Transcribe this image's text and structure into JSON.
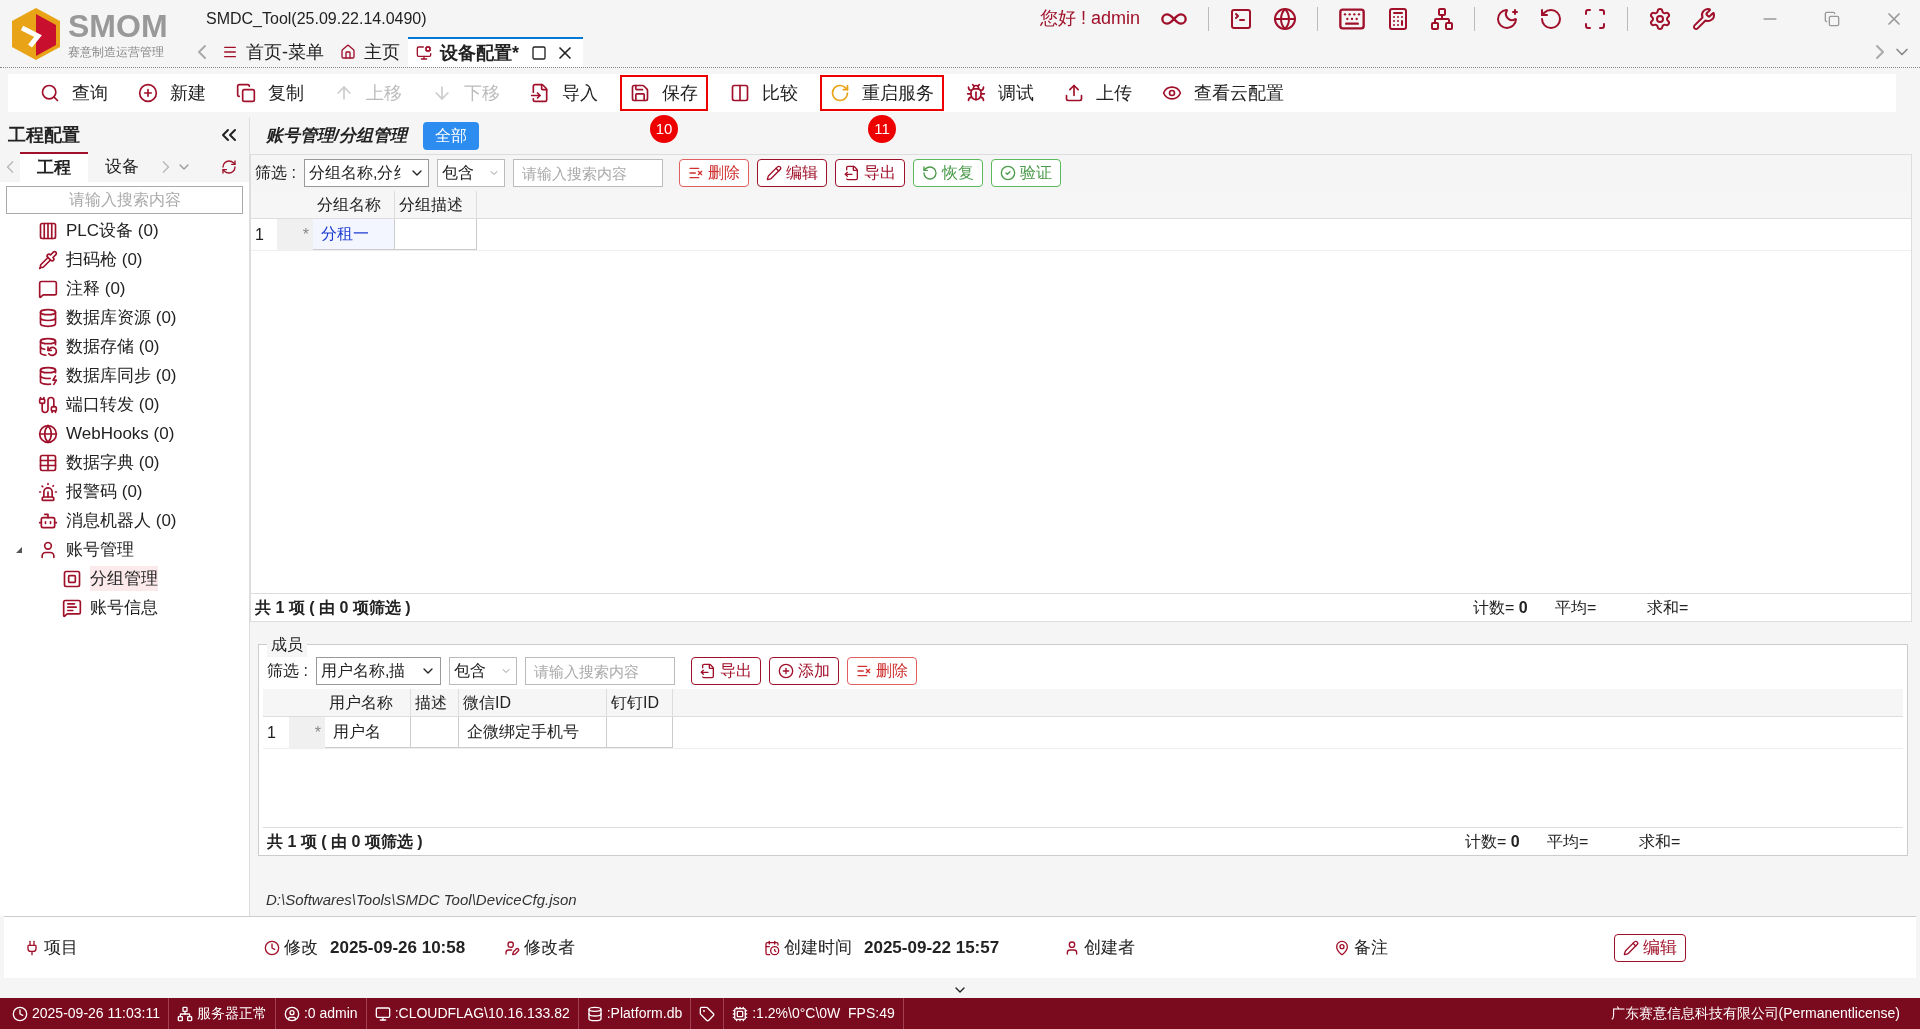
{
  "logo": {
    "mark": "SMOM",
    "subtitle": "赛意制造运营管理"
  },
  "window": {
    "title": "SMDC_Tool(25.09.22.14.0490)",
    "greeting": "您好 ! admin"
  },
  "doc_tabs": [
    {
      "label": "首页-菜单",
      "kind": "menu",
      "selected": false
    },
    {
      "label": "主页",
      "kind": "home",
      "selected": false
    },
    {
      "label": "设备配置*",
      "kind": "config",
      "selected": true
    }
  ],
  "toolbar": [
    {
      "label": "查询",
      "kind": "search",
      "disabled": false
    },
    {
      "label": "新建",
      "kind": "new",
      "disabled": false
    },
    {
      "label": "复制",
      "kind": "copy",
      "disabled": false
    },
    {
      "label": "上移",
      "kind": "up",
      "disabled": true
    },
    {
      "label": "下移",
      "kind": "down",
      "disabled": true
    },
    {
      "label": "导入",
      "kind": "import",
      "disabled": false
    },
    {
      "label": "保存",
      "kind": "save",
      "disabled": false,
      "callout": "10"
    },
    {
      "label": "比较",
      "kind": "compare",
      "disabled": false
    },
    {
      "label": "重启服务",
      "kind": "restart",
      "disabled": false,
      "callout": "11"
    },
    {
      "label": "调试",
      "kind": "debug",
      "disabled": false
    },
    {
      "label": "上传",
      "kind": "upload",
      "disabled": false
    },
    {
      "label": "查看云配置",
      "kind": "view",
      "disabled": false
    }
  ],
  "sidebar": {
    "title": "工程配置",
    "tabs": [
      {
        "label": "工程",
        "selected": true
      },
      {
        "label": "设备",
        "selected": false
      }
    ],
    "search_placeholder": "请输入搜索内容",
    "items": [
      {
        "label": "PLC设备 (0)",
        "kind": "plc"
      },
      {
        "label": "扫码枪 (0)",
        "kind": "scanner"
      },
      {
        "label": "注释 (0)",
        "kind": "comment"
      },
      {
        "label": "数据库资源 (0)",
        "kind": "database"
      },
      {
        "label": "数据存储 (0)",
        "kind": "storage"
      },
      {
        "label": "数据库同步 (0)",
        "kind": "sync"
      },
      {
        "label": "端口转发 (0)",
        "kind": "port"
      },
      {
        "label": "WebHooks (0)",
        "kind": "web"
      },
      {
        "label": "数据字典 (0)",
        "kind": "dict"
      },
      {
        "label": "报警码 (0)",
        "kind": "alarm"
      },
      {
        "label": "消息机器人 (0)",
        "kind": "bot"
      },
      {
        "label": "账号管理",
        "kind": "account",
        "expanded": true,
        "children": [
          {
            "label": "分组管理",
            "kind": "group",
            "selected": true
          },
          {
            "label": "账号信息",
            "kind": "info",
            "selected": false
          }
        ]
      }
    ]
  },
  "groups": {
    "breadcrumb": "账号管理/分组管理",
    "all_button": "全部",
    "filter_label": "筛选 :",
    "filter_field": "分组名称,分纟",
    "filter_op": "包含",
    "search_placeholder": "请输入搜索内容",
    "actions": [
      {
        "label": "删除",
        "kind": "delete"
      },
      {
        "label": "编辑",
        "kind": "edit"
      },
      {
        "label": "导出",
        "kind": "export"
      },
      {
        "label": "恢复",
        "kind": "restore"
      },
      {
        "label": "验证",
        "kind": "verify"
      }
    ],
    "columns": [
      "分组名称",
      "分组描述"
    ],
    "rows": [
      {
        "index": "1",
        "marker": "*",
        "cells": [
          "分租一",
          ""
        ]
      }
    ],
    "summary": "共 1 项 ( 由 0 项筛选 )",
    "count_label": "计数=",
    "count": "0",
    "avg_label": "平均=",
    "sum_label": "求和="
  },
  "members": {
    "legend": "成员",
    "filter_label": "筛选 :",
    "filter_field": "用户名称,描",
    "filter_op": "包含",
    "search_placeholder": "请输入搜索内容",
    "actions": [
      {
        "label": "导出",
        "kind": "export"
      },
      {
        "label": "添加",
        "kind": "add"
      },
      {
        "label": "删除",
        "kind": "delete"
      }
    ],
    "columns": [
      "用户名称",
      "描述",
      "微信ID",
      "钉钉ID"
    ],
    "rows": [
      {
        "index": "1",
        "marker": "*",
        "cells": [
          "用户名",
          "",
          "企微绑定手机号",
          ""
        ]
      }
    ],
    "summary": "共 1 项 ( 由 0 项筛选 )",
    "count_label": "计数=",
    "count": "0",
    "avg_label": "平均=",
    "sum_label": "求和="
  },
  "file_path": "D:\\Softwares\\Tools\\SMDC Tool\\DeviceCfg.json",
  "info": [
    {
      "kind": "project",
      "label": "项目"
    },
    {
      "kind": "modified",
      "label": "修改",
      "value": "2025-09-26 10:58"
    },
    {
      "kind": "modifier",
      "label": "修改者"
    },
    {
      "kind": "created",
      "label": "创建时间",
      "value": "2025-09-22 15:57"
    },
    {
      "kind": "creator",
      "label": "创建者"
    },
    {
      "kind": "note",
      "label": "备注"
    }
  ],
  "edit_button": "编辑",
  "status_bar": {
    "items": [
      {
        "kind": "clock",
        "text": "2025-09-26 11:03:11"
      },
      {
        "kind": "server",
        "text": "服务器正常"
      },
      {
        "kind": "user",
        "text": ":0 admin"
      },
      {
        "kind": "host",
        "text": ":CLOUDFLAG\\10.16.133.82"
      },
      {
        "kind": "db",
        "text": ":Platform.db"
      },
      {
        "kind": "tag"
      },
      {
        "kind": "cpu",
        "text": ":1.2%\\0°C\\0W  FPS:49"
      }
    ],
    "company": "广东赛意信息科技有限公司(Permanentlicense)"
  }
}
